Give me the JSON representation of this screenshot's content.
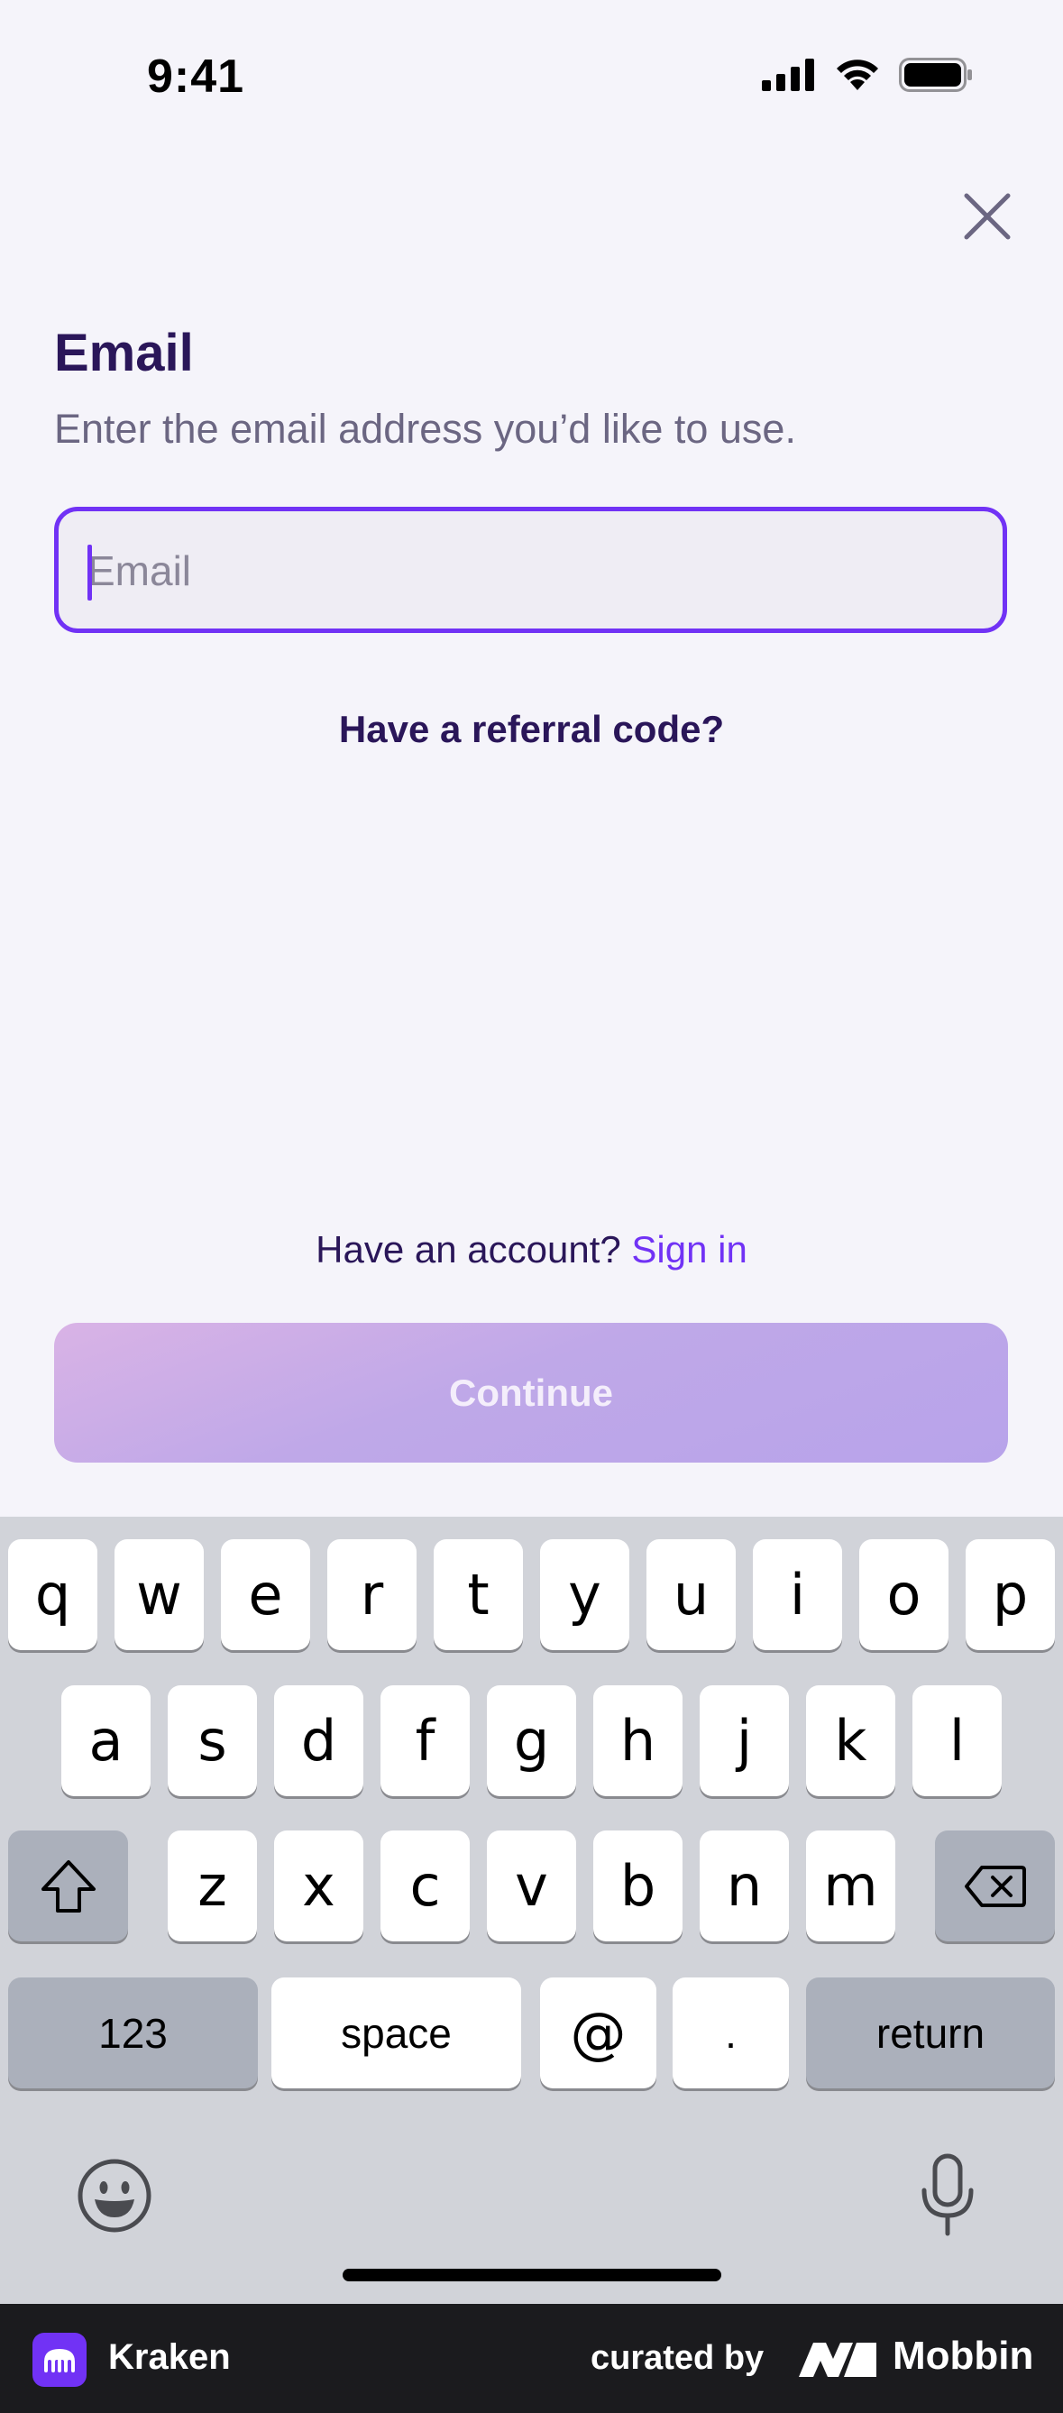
{
  "status_bar": {
    "time": "9:41"
  },
  "header": {
    "title": "Email",
    "subtitle": "Enter the email address you’d like to use."
  },
  "email_input": {
    "placeholder": "Email",
    "value": ""
  },
  "referral_link": "Have a referral code?",
  "account": {
    "prompt": "Have an account?",
    "signin": "Sign in"
  },
  "continue_button": "Continue",
  "keyboard": {
    "row1": [
      "q",
      "w",
      "e",
      "r",
      "t",
      "y",
      "u",
      "i",
      "o",
      "p"
    ],
    "row2": [
      "a",
      "s",
      "d",
      "f",
      "g",
      "h",
      "j",
      "k",
      "l"
    ],
    "row3": [
      "z",
      "x",
      "c",
      "v",
      "b",
      "n",
      "m"
    ],
    "numbers": "123",
    "space": "space",
    "at": "@",
    "dot": ".",
    "return": "return"
  },
  "footer": {
    "app_name": "Kraken",
    "curated_by": "curated by",
    "brand": "Mobbin"
  },
  "colors": {
    "accent": "#7132f5",
    "title": "#2a1659",
    "background": "#f5f4fa"
  }
}
